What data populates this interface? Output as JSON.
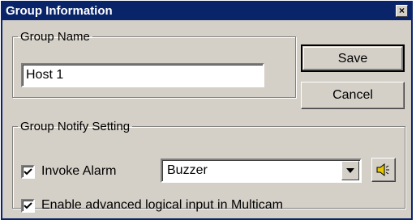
{
  "window": {
    "title": "Group Information",
    "close_glyph": "×"
  },
  "group_name": {
    "legend": "Group Name",
    "value": "Host 1"
  },
  "buttons": {
    "save": "Save",
    "cancel": "Cancel"
  },
  "notify": {
    "legend": "Group Notify Setting",
    "invoke_alarm": {
      "label": "Invoke Alarm",
      "checked": true
    },
    "alarm_type": {
      "selected": "Buzzer"
    },
    "advanced_input": {
      "label": "Enable advanced logical input in Multicam",
      "checked": true
    }
  },
  "icons": {
    "close": "close-icon",
    "dropdown": "chevron-down-icon",
    "speaker": "speaker-icon",
    "check": "checkmark-icon"
  },
  "colors": {
    "titlebar": "#0a246a",
    "window_bg": "#d4d0c8",
    "speaker": "#e8c800"
  }
}
